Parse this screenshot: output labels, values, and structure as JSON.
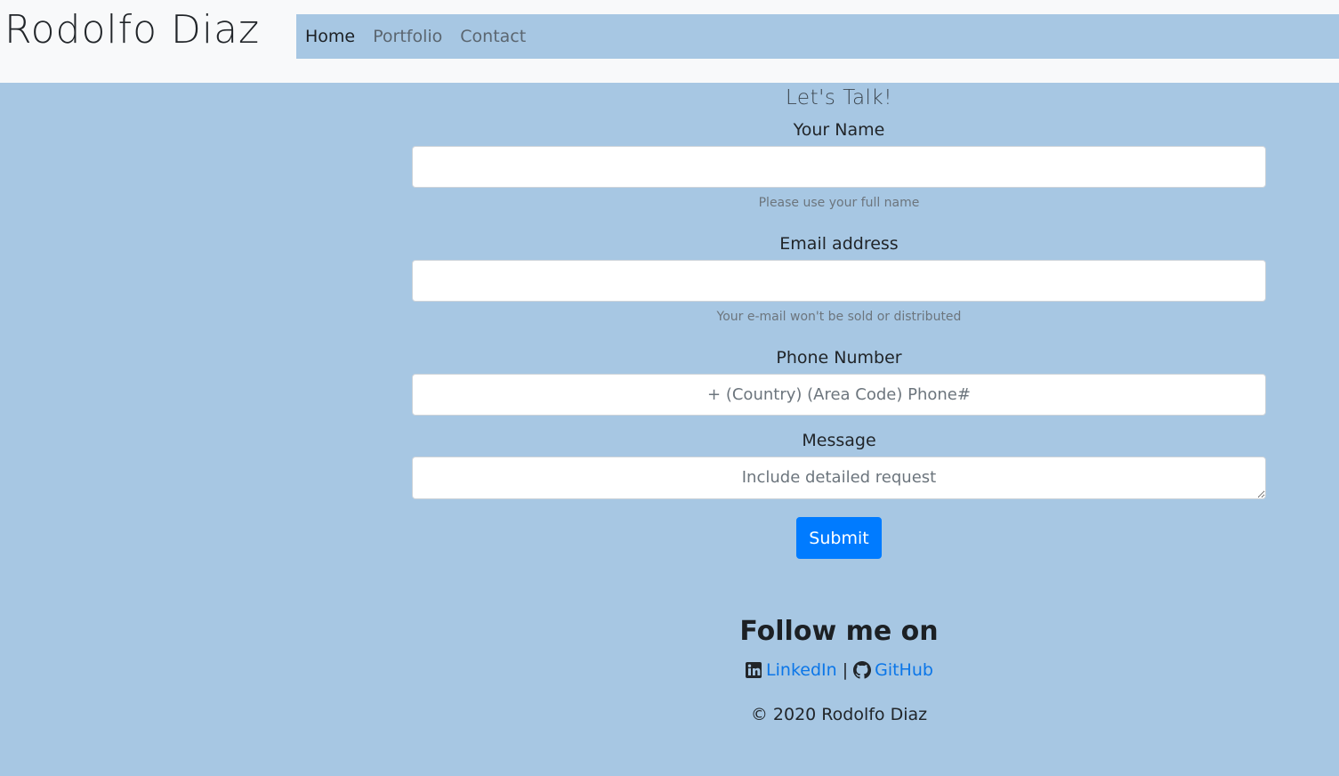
{
  "header": {
    "brand": "Rodolfo Diaz",
    "nav": [
      {
        "label": "Home",
        "active": true
      },
      {
        "label": "Portfolio",
        "active": false
      },
      {
        "label": "Contact",
        "active": false
      }
    ]
  },
  "form": {
    "title": "Let's Talk!",
    "name": {
      "label": "Your Name",
      "placeholder": "",
      "help": "Please use your full name"
    },
    "email": {
      "label": "Email address",
      "placeholder": "",
      "help": "Your e-mail won't be sold or distributed"
    },
    "phone": {
      "label": "Phone Number",
      "placeholder": "+ (Country) (Area Code) Phone#"
    },
    "message": {
      "label": "Message",
      "placeholder": "Include detailed request"
    },
    "submit_label": "Submit"
  },
  "footer": {
    "follow_heading": "Follow me on",
    "linkedin_label": "LinkedIn",
    "separator": "|",
    "github_label": "GitHub",
    "copyright": "© 2020 Rodolfo Diaz"
  },
  "colors": {
    "page_background": "#a7c7e3",
    "header_background": "#f8f9fa",
    "primary": "#007bff",
    "link": "#0b76e8"
  },
  "icons": {
    "linkedin": "linkedin-icon",
    "github": "github-icon"
  }
}
